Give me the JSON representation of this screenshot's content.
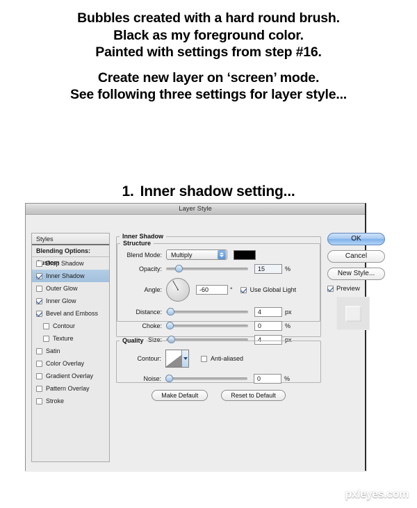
{
  "instructions": {
    "group1": [
      "Bubbles created with a hard round brush.",
      "Black as my foreground color.",
      "Painted with settings from step #16."
    ],
    "group2": [
      "Create new layer on ‘screen’ mode.",
      "See following three settings for layer style..."
    ]
  },
  "step_heading": {
    "number": "1.",
    "text": "Inner shadow setting..."
  },
  "dialog": {
    "title": "Layer Style",
    "styles_panel": {
      "header": "Styles",
      "blending_options": "Blending Options: Custom",
      "items": [
        {
          "label": "Drop Shadow",
          "checked": false,
          "selected": false,
          "indent": false
        },
        {
          "label": "Inner Shadow",
          "checked": true,
          "selected": true,
          "indent": false
        },
        {
          "label": "Outer Glow",
          "checked": false,
          "selected": false,
          "indent": false
        },
        {
          "label": "Inner Glow",
          "checked": true,
          "selected": false,
          "indent": false
        },
        {
          "label": "Bevel and Emboss",
          "checked": true,
          "selected": false,
          "indent": false
        },
        {
          "label": "Contour",
          "checked": false,
          "selected": false,
          "indent": true
        },
        {
          "label": "Texture",
          "checked": false,
          "selected": false,
          "indent": true
        },
        {
          "label": "Satin",
          "checked": false,
          "selected": false,
          "indent": false
        },
        {
          "label": "Color Overlay",
          "checked": false,
          "selected": false,
          "indent": false
        },
        {
          "label": "Gradient Overlay",
          "checked": false,
          "selected": false,
          "indent": false
        },
        {
          "label": "Pattern Overlay",
          "checked": false,
          "selected": false,
          "indent": false
        },
        {
          "label": "Stroke",
          "checked": false,
          "selected": false,
          "indent": false
        }
      ]
    },
    "buttons": {
      "ok": "OK",
      "cancel": "Cancel",
      "new_style": "New Style...",
      "preview_label": "Preview",
      "preview_checked": true
    },
    "inner_shadow": {
      "group_title": "Inner Shadow",
      "structure": {
        "group_title": "Structure",
        "blend_mode_label": "Blend Mode:",
        "blend_mode_value": "Multiply",
        "shadow_color": "#000000",
        "opacity_label": "Opacity:",
        "opacity_value": "15",
        "opacity_unit": "%",
        "angle_label": "Angle:",
        "angle_value": "-60",
        "angle_unit": "°",
        "use_global_light_label": "Use Global Light",
        "use_global_light_checked": true,
        "distance_label": "Distance:",
        "distance_value": "4",
        "distance_unit": "px",
        "choke_label": "Choke:",
        "choke_value": "0",
        "choke_unit": "%",
        "size_label": "Size:",
        "size_value": "4",
        "size_unit": "px"
      },
      "quality": {
        "group_title": "Quality",
        "contour_label": "Contour:",
        "anti_aliased_label": "Anti-aliased",
        "anti_aliased_checked": false,
        "noise_label": "Noise:",
        "noise_value": "0",
        "noise_unit": "%"
      },
      "make_default": "Make Default",
      "reset_to_default": "Reset to Default"
    }
  },
  "watermark": "pxleyes.com"
}
